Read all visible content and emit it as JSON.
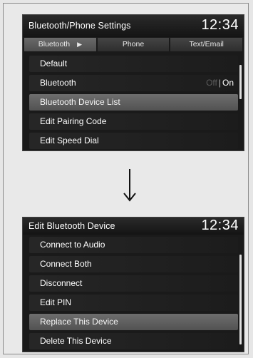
{
  "screen1": {
    "title": "Bluetooth/Phone Settings",
    "clock": "12:34",
    "tabs": [
      {
        "label": "Bluetooth",
        "arrow": "▶"
      },
      {
        "label": "Phone"
      },
      {
        "label": "Text/Email"
      }
    ],
    "items": [
      {
        "label": "Default"
      },
      {
        "label": "Bluetooth",
        "toggle_off": "Off",
        "toggle_sep": "|",
        "toggle_on": "On"
      },
      {
        "label": "Bluetooth Device List"
      },
      {
        "label": "Edit Pairing Code"
      },
      {
        "label": "Edit Speed Dial"
      }
    ],
    "selected_index": 2
  },
  "screen2": {
    "title": "Edit Bluetooth Device",
    "clock": "12:34",
    "items": [
      {
        "label": "Connect to Audio"
      },
      {
        "label": "Connect Both"
      },
      {
        "label": "Disconnect"
      },
      {
        "label": "Edit PIN"
      },
      {
        "label": "Replace This Device"
      },
      {
        "label": "Delete This Device"
      }
    ],
    "selected_index": 4
  },
  "colors": {
    "screen_bg": "#1a1a1a",
    "selected_row": "#5e5e5e",
    "page_bg": "#e6e6e6"
  },
  "icons": {
    "flow_arrow": "down-arrow-icon"
  }
}
